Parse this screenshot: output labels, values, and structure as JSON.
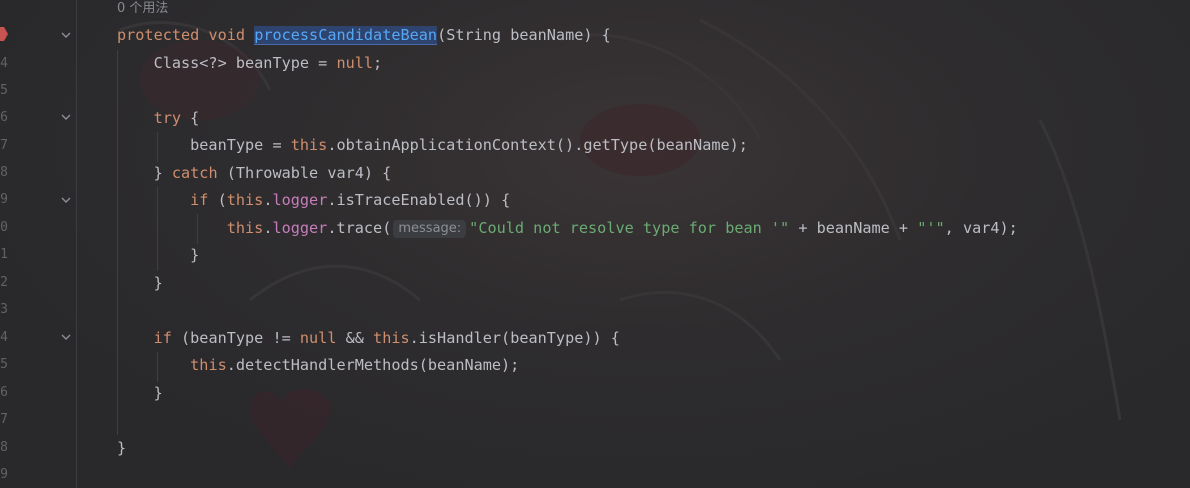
{
  "editor": {
    "usages_hint": "0 个用法",
    "gutter": {
      "line_numbers": [
        "4",
        "5",
        "6",
        "7",
        "8",
        "9",
        "0",
        "1",
        "2",
        "3",
        "4",
        "5",
        "6",
        "7",
        "8",
        "9"
      ]
    },
    "param_hint": "message:",
    "code": {
      "l1": {
        "t1": "protected",
        "t2": " ",
        "t3": "void",
        "t4": " ",
        "t5": "processCandidateBean",
        "t6": "(String beanName) {"
      },
      "l2": {
        "t1": "    Class<?> beanType = ",
        "t2": "null",
        "t3": ";"
      },
      "l4": {
        "t1": "    ",
        "t2": "try",
        "t3": " {"
      },
      "l5": {
        "t1": "        beanType = ",
        "t2": "this",
        ".t3": "",
        "t3": ".obtainApplicationContext().getType(beanName);"
      },
      "l6": {
        "t1": "    } ",
        "t2": "catch",
        "t3": " (Throwable var4) {"
      },
      "l7": {
        "t1": "        ",
        "t2": "if",
        "t3": " (",
        "t4": "this",
        "t5": ".",
        "t6": "logger",
        "t7": ".isTraceEnabled()) {"
      },
      "l8": {
        "t1": "            ",
        "t2": "this",
        "t3": ".",
        "t4": "logger",
        "t5": ".trace(",
        "t6": "\"Could not resolve type for bean '\"",
        "t7": " + beanName + ",
        "t8": "\"'\"",
        "t9": ", var4);"
      },
      "l9": {
        "t1": "        }"
      },
      "l10": {
        "t1": "    }"
      },
      "l12": {
        "t1": "    ",
        "t2": "if",
        "t3": " (beanType != ",
        "t4": "null",
        "t5": " && ",
        "t6": "this",
        "t7": ".isHandler(beanType)) {"
      },
      "l13": {
        "t1": "        ",
        "t2": "this",
        "t3": ".detectHandlerMethods(beanName);"
      },
      "l14": {
        "t1": "    }"
      },
      "l16": {
        "t1": "}"
      }
    },
    "colors": {
      "keyword": "#cf8e6d",
      "method_decl": "#56a8f5",
      "field": "#c77dbb",
      "string": "#6aab73",
      "default_text": "#bcbec4",
      "background": "#2b2d30"
    },
    "icons": [
      "breakpoint-icon",
      "fold-arrow-icon"
    ]
  }
}
